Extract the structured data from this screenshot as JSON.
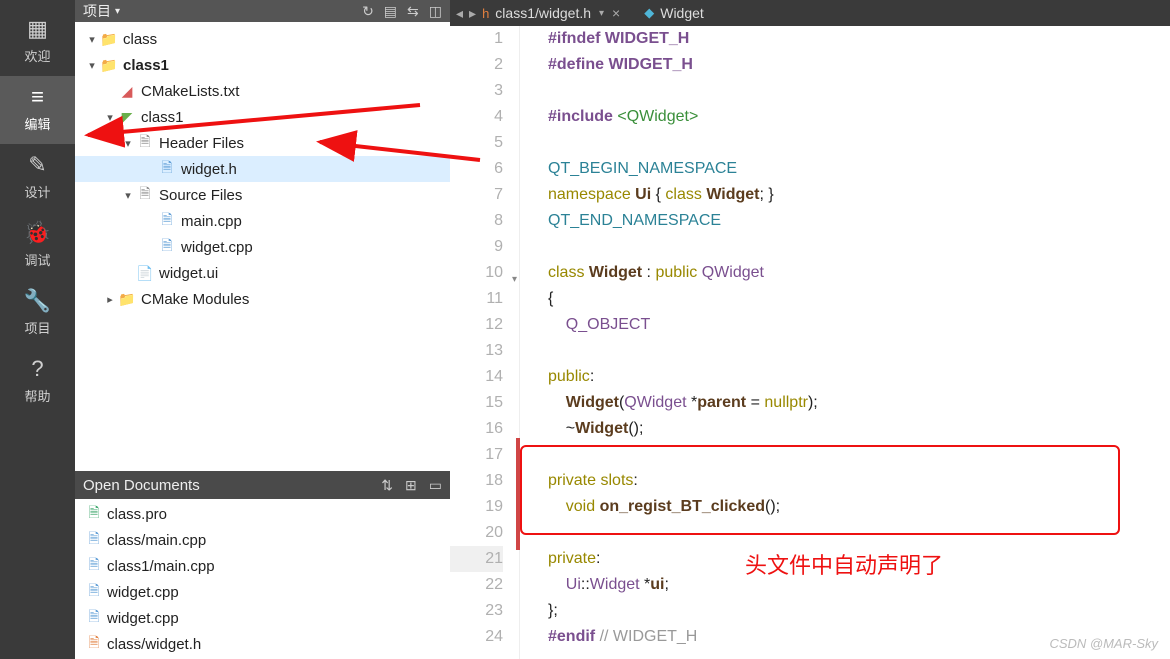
{
  "rail": [
    {
      "icon": "▦",
      "label": "欢迎",
      "active": false
    },
    {
      "icon": "≡",
      "label": "编辑",
      "active": true
    },
    {
      "icon": "✎",
      "label": "设计",
      "active": false
    },
    {
      "icon": "🐞",
      "label": "调试",
      "active": false
    },
    {
      "icon": "🔧",
      "label": "项目",
      "active": false
    },
    {
      "icon": "?",
      "label": "帮助",
      "active": false
    }
  ],
  "project_header": "项目",
  "tree": [
    {
      "depth": 0,
      "arrow": "▾",
      "iconColor": "#d8a63a",
      "label": "class",
      "bold": false
    },
    {
      "depth": 0,
      "arrow": "▾",
      "iconColor": "#d8a63a",
      "label": "class1",
      "bold": true
    },
    {
      "depth": 1,
      "arrow": "",
      "iconColor": "#d85a5a",
      "label": "CMakeLists.txt",
      "bold": false,
      "icon": "◢"
    },
    {
      "depth": 1,
      "arrow": "▾",
      "iconColor": "#6ab04c",
      "label": "class1",
      "bold": false,
      "icon": "◤"
    },
    {
      "depth": 2,
      "arrow": "▾",
      "iconColor": "#888",
      "label": "Header Files",
      "bold": false,
      "icon": "🗎"
    },
    {
      "depth": 3,
      "arrow": "",
      "iconColor": "#5b9bd5",
      "label": "widget.h",
      "bold": false,
      "icon": "🗎",
      "selected": true
    },
    {
      "depth": 2,
      "arrow": "▾",
      "iconColor": "#888",
      "label": "Source Files",
      "bold": false,
      "icon": "🗎"
    },
    {
      "depth": 3,
      "arrow": "",
      "iconColor": "#5b9bd5",
      "label": "main.cpp",
      "bold": false,
      "icon": "🗎"
    },
    {
      "depth": 3,
      "arrow": "",
      "iconColor": "#5b9bd5",
      "label": "widget.cpp",
      "bold": false,
      "icon": "🗎"
    },
    {
      "depth": 2,
      "arrow": "",
      "iconColor": "#d8a63a",
      "label": "widget.ui",
      "bold": false,
      "icon": "📄"
    },
    {
      "depth": 1,
      "arrow": "▸",
      "iconColor": "#d8a63a",
      "label": "CMake Modules",
      "bold": false,
      "icon": "📁"
    }
  ],
  "open_docs_title": "Open Documents",
  "open_docs": [
    {
      "icon": "🗎",
      "color": "#3aa66a",
      "label": "class.pro"
    },
    {
      "icon": "🗎",
      "color": "#5b9bd5",
      "label": "class/main.cpp"
    },
    {
      "icon": "🗎",
      "color": "#5b9bd5",
      "label": "class1/main.cpp"
    },
    {
      "icon": "🗎",
      "color": "#5b9bd5",
      "label": "widget.cpp"
    },
    {
      "icon": "🗎",
      "color": "#5b9bd5",
      "label": "widget.cpp"
    },
    {
      "icon": "🗎",
      "color": "#e27f3f",
      "label": "class/widget.h"
    }
  ],
  "tabs": [
    {
      "type": "h",
      "label": "class1/widget.h"
    },
    {
      "type": "w",
      "label": "Widget"
    }
  ],
  "code_lines": [
    {
      "n": 1,
      "html": "<span class='kw-pre'>#ifndef</span> <span class='kw-id'>WIDGET_H</span>"
    },
    {
      "n": 2,
      "html": "<span class='kw-pre'>#define</span> <span class='kw-id'>WIDGET_H</span>"
    },
    {
      "n": 3,
      "html": ""
    },
    {
      "n": 4,
      "html": "<span class='kw-pre'>#include</span> <span class='inc'>&lt;QWidget&gt;</span>"
    },
    {
      "n": 5,
      "html": ""
    },
    {
      "n": 6,
      "html": "<span class='ns'>QT_BEGIN_NAMESPACE</span>"
    },
    {
      "n": 7,
      "html": "<span class='kw'>namespace</span> <span class='name'>Ui</span> <span class='plain'>{</span> <span class='kw'>class</span> <span class='name'>Widget</span><span class='plain'>; }</span>"
    },
    {
      "n": 8,
      "html": "<span class='ns'>QT_END_NAMESPACE</span>"
    },
    {
      "n": 9,
      "html": ""
    },
    {
      "n": 10,
      "html": "<span class='kw'>class</span> <span class='name'>Widget</span> <span class='plain'>:</span> <span class='kw'>public</span> <span class='type'>QWidget</span>",
      "fold": true
    },
    {
      "n": 11,
      "html": "<span class='plain'>{</span>"
    },
    {
      "n": 12,
      "html": "    <span class='type'>Q_OBJECT</span>"
    },
    {
      "n": 13,
      "html": ""
    },
    {
      "n": 14,
      "html": "<span class='kw'>public</span><span class='plain'>:</span>"
    },
    {
      "n": 15,
      "html": "    <span class='name'>Widget</span><span class='plain'>(</span><span class='type'>QWidget</span> <span class='plain'>*</span><span class='name'>parent</span> <span class='plain'>=</span> <span class='kw'>nullptr</span><span class='plain'>);</span>"
    },
    {
      "n": 16,
      "html": "    <span class='plain'>~</span><span class='name'>Widget</span><span class='plain'>();</span>"
    },
    {
      "n": 17,
      "html": ""
    },
    {
      "n": 18,
      "html": "<span class='kw'>private</span> <span class='kw'>slots</span><span class='plain'>:</span>"
    },
    {
      "n": 19,
      "html": "    <span class='kw'>void</span> <span class='name'>on_regist_BT_clicked</span><span class='plain'>();</span>"
    },
    {
      "n": 20,
      "html": ""
    },
    {
      "n": 21,
      "html": "<span class='kw'>private</span><span class='plain'>:</span>",
      "current": true
    },
    {
      "n": 22,
      "html": "    <span class='type'>Ui</span><span class='plain'>::</span><span class='type'>Widget</span> <span class='plain'>*</span><span class='name'>ui</span><span class='plain'>;</span>"
    },
    {
      "n": 23,
      "html": "<span class='plain'>};</span>"
    },
    {
      "n": 24,
      "html": "<span class='kw-pre'>#endif</span> <span class='comment'>// WIDGET_H</span>"
    }
  ],
  "annotation_text": "头文件中自动声明了",
  "watermark": "CSDN @MAR-Sky"
}
